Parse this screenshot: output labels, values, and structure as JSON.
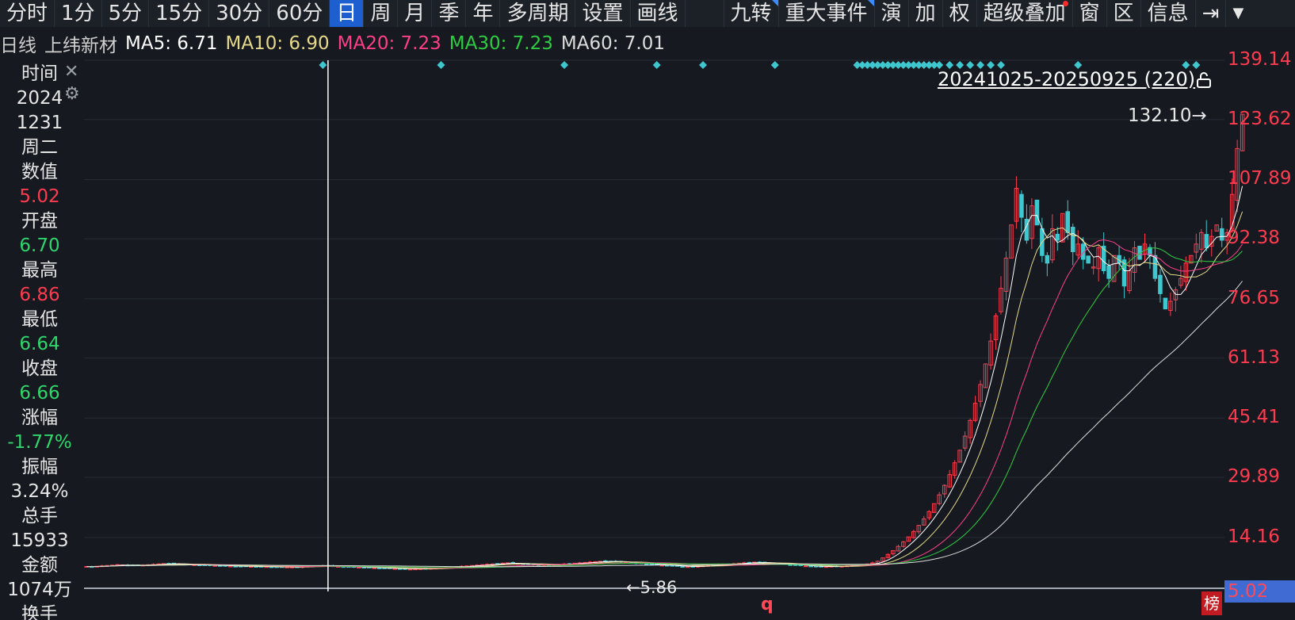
{
  "toolbar": {
    "items": [
      "分时",
      "1分",
      "5分",
      "15分",
      "30分",
      "60分",
      "日",
      "周",
      "月",
      "季",
      "年",
      "多周期",
      "设置",
      "画线"
    ],
    "active_index": 6,
    "right_items": [
      "九转",
      "重大事件",
      "演",
      "加",
      "权",
      "超级叠加",
      "窗",
      "区",
      "信息"
    ],
    "right_flags": [
      0,
      1
    ],
    "right_dot_index": 5,
    "expand_icon": "panel-collapse-icon",
    "menu_icon": "dropdown-triangle-icon"
  },
  "ma_bar": {
    "period": "日线",
    "stock": "上纬新材",
    "ma5": "MA5: 6.71",
    "ma10": "MA10: 6.90",
    "ma20": "MA20: 7.23",
    "ma30": "MA30: 7.23",
    "ma60": "MA60: 7.01"
  },
  "colors": {
    "up": "#ff3b4f",
    "down": "#3fc7cf",
    "ma5": "#ffffff",
    "ma10": "#e6d98a",
    "ma20": "#ff3e8a",
    "ma30": "#2ecc40",
    "ma60": "#dddddd",
    "grid": "#262b33",
    "green_text": "#2ed66b"
  },
  "side_panel": {
    "time_label": "时间",
    "date_year": "2024",
    "date_md": "1231",
    "weekday": "周二",
    "value_label": "数值",
    "value": "5.02",
    "open_label": "开盘",
    "open": "6.70",
    "high_label": "最高",
    "high": "6.86",
    "low_label": "最低",
    "low": "6.64",
    "close_label": "收盘",
    "close": "6.66",
    "change_label": "涨幅",
    "change": "-1.77%",
    "amplitude_label": "振幅",
    "amplitude": "3.24%",
    "volume_label": "总手",
    "volume": "15933",
    "amount_label": "金额",
    "amount": "1074万",
    "turnover_label": "换手"
  },
  "chart_data": {
    "type": "candlestick",
    "title": "上纬新材 日线",
    "date_range": "20241025-20250925 (220)",
    "y_ticks": [
      "139.14",
      "123.62",
      "107.89",
      "92.38",
      "76.65",
      "61.13",
      "45.41",
      "29.89",
      "14.16"
    ],
    "y_current": "5.02",
    "ylim": [
      0,
      139.14
    ],
    "x_count": 220,
    "crosshair_index": 47,
    "max_label": "132.10",
    "min_label": "5.86",
    "closes": [
      6.55,
      6.5,
      6.6,
      6.7,
      6.8,
      6.9,
      7.0,
      6.95,
      6.9,
      6.85,
      6.8,
      6.9,
      7.0,
      7.1,
      7.2,
      7.3,
      7.3,
      7.25,
      7.2,
      7.1,
      7.05,
      7.0,
      6.95,
      6.9,
      6.8,
      6.8,
      6.75,
      6.7,
      6.65,
      6.6,
      6.6,
      6.6,
      6.55,
      6.5,
      6.5,
      6.5,
      6.45,
      6.4,
      6.4,
      6.4,
      6.4,
      6.4,
      6.5,
      6.6,
      6.65,
      6.7,
      6.78,
      6.66,
      6.6,
      6.55,
      6.5,
      6.45,
      6.4,
      6.35,
      6.3,
      6.25,
      6.2,
      6.15,
      6.1,
      6.05,
      6.0,
      5.95,
      5.9,
      5.86,
      5.9,
      5.95,
      6.0,
      6.05,
      6.1,
      6.2,
      6.3,
      6.4,
      6.5,
      6.6,
      6.7,
      6.8,
      6.9,
      7.0,
      7.1,
      7.2,
      7.3,
      7.4,
      7.5,
      7.4,
      7.3,
      7.2,
      7.1,
      7.0,
      6.9,
      6.9,
      6.95,
      7.0,
      7.1,
      7.2,
      7.3,
      7.4,
      7.5,
      7.6,
      7.7,
      7.8,
      7.9,
      8.0,
      7.9,
      7.8,
      7.7,
      7.6,
      7.5,
      7.4,
      7.3,
      7.2,
      7.1,
      7.0,
      6.9,
      6.8,
      6.7,
      6.6,
      6.5,
      6.5,
      6.5,
      6.6,
      6.7,
      6.8,
      6.9,
      7.0,
      7.1,
      7.2,
      7.3,
      7.4,
      7.5,
      7.6,
      7.7,
      7.6,
      7.5,
      7.4,
      7.3,
      7.2,
      7.1,
      7.0,
      6.9,
      6.8,
      6.7,
      6.6,
      6.5,
      6.5,
      6.5,
      6.6,
      6.6,
      6.6,
      6.7,
      6.8,
      6.9,
      7.0,
      7.2,
      7.5,
      7.9,
      8.8,
      9.7,
      10.7,
      11.8,
      13.0,
      14.3,
      15.7,
      17.3,
      19.0,
      20.9,
      23.0,
      25.3,
      27.8,
      30.6,
      33.7,
      37.0,
      40.7,
      44.8,
      49.3,
      54.2,
      59.6,
      65.6,
      72.2,
      79.4,
      87.3,
      96.0,
      105.6,
      98.0,
      92.0,
      101.0,
      96.0,
      88.0,
      86.0,
      95.0,
      92.0,
      99.0,
      94.0,
      89.0,
      91.0,
      87.0,
      86.0,
      85.0,
      90.0,
      84.0,
      82.0,
      88.0,
      86.0,
      80.0,
      84.0,
      90.0,
      87.0,
      91.0,
      88.0,
      82.0,
      78.0,
      74.0,
      76.0,
      79.0,
      82.0,
      86.0,
      88.0,
      91.0,
      94.0,
      90.0,
      93.0,
      96.0,
      92.0,
      94.0,
      104.0,
      116.0,
      125.0
    ],
    "ma5": [],
    "ma10": [],
    "ma20": [],
    "ma30": [],
    "ma60": [],
    "event_marker_indices": [
      46,
      69,
      93,
      111,
      120,
      134,
      150,
      151,
      152,
      153,
      154,
      155,
      156,
      157,
      158,
      159,
      160,
      161,
      162,
      163,
      164,
      165,
      166,
      168,
      170,
      172,
      174,
      176,
      178,
      193,
      214,
      216
    ]
  }
}
